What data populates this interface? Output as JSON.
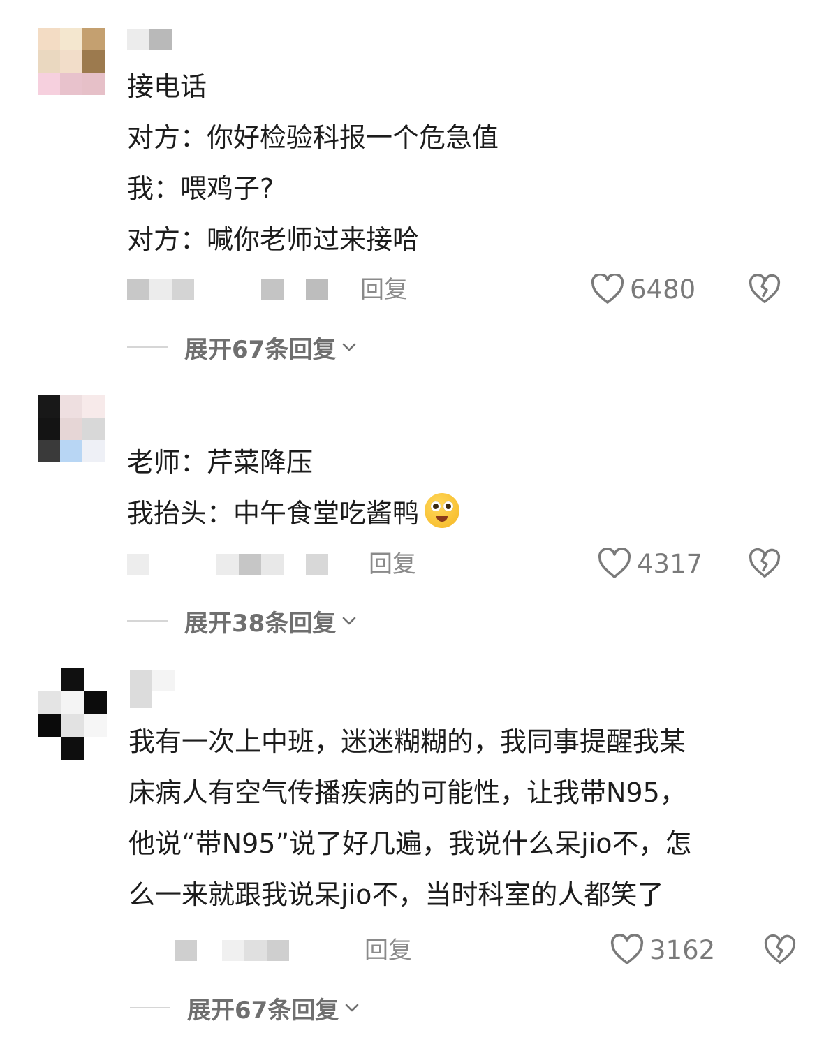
{
  "comments": [
    {
      "lines": [
        "接电话",
        "对方：你好检验科报一个危急值",
        "我：喂鸡子?",
        "对方：喊你老师过来接哈"
      ],
      "reply_label": "回复",
      "likes": "6480",
      "expand_label": "展开67条回复"
    },
    {
      "lines": [
        "老师：芹菜降压",
        "我抬头：中午食堂吃酱鸭"
      ],
      "reply_label": "回复",
      "likes": "4317",
      "expand_label": "展开38条回复"
    },
    {
      "lines": [
        "我有一次上中班，迷迷糊糊的，我同事提醒我某",
        "床病人有空气传播疾病的可能性，让我带N95，",
        "他说“带N95”说了好几遍，我说什么呆jio不，怎",
        "么一来就跟我说呆jio不，当时科室的人都笑了"
      ],
      "reply_label": "回复",
      "likes": "3162",
      "expand_label": "展开67条回复"
    }
  ],
  "icons": {
    "like": "heart-outline-icon",
    "dislike": "broken-heart-icon",
    "expand": "chevron-down-icon",
    "emoji": "starry-eyes-emoji"
  },
  "colors": {
    "text": "#1c1c1c",
    "muted": "#8a8a8a",
    "icon": "#7a7a7a"
  }
}
